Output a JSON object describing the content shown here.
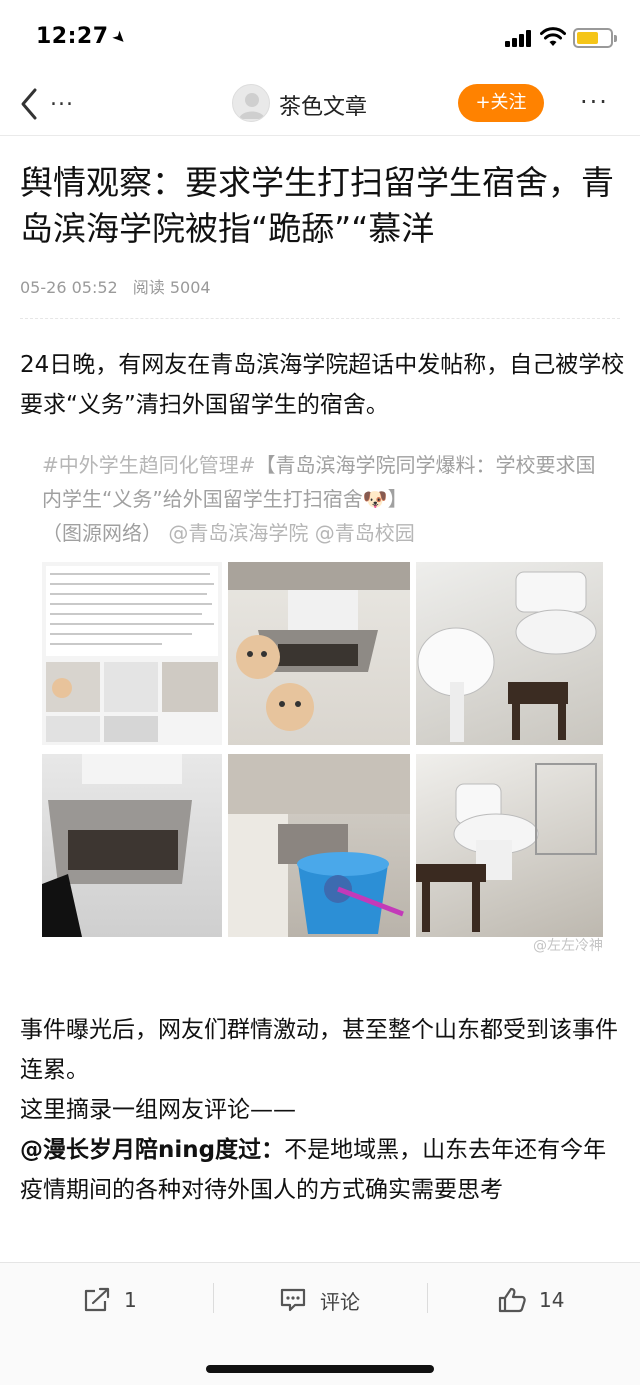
{
  "status": {
    "time": "12:27"
  },
  "nav": {
    "ellipsis": "...",
    "author": "茶色文章",
    "follow": "+关注",
    "more": "···"
  },
  "article": {
    "title": "舆情观察：要求学生打扫留学生宿舍，青岛滨海学院被指“跪舔”“慕洋",
    "date": "05-26 05:52",
    "reads": "阅读 5004",
    "p1": "24日晚，有网友在青岛滨海学院超话中发帖称，自己被学校要求“义务”清扫外国留学生的宿舍。",
    "p2_l1": "事件曝光后，网友们群情激动，甚至整个山东都受到该事件连累。",
    "p2_l2": "这里摘录一组网友评论——",
    "p2_user": "@漫长岁月陪ning度过：",
    "p2_text": "不是地域黑，山东去年还有今年疫情期间的各种对待外国人的方式确实需要思考"
  },
  "figure": {
    "caption_tag": "#中外学生趋同化管理#",
    "caption_main": "【青岛滨海学院同学爆料：学校要求国内学生“义务”给外国留学生打扫宿舍🐶】",
    "caption_src": "（图源网络）",
    "caption_mentions": "@青岛滨海学院 @青岛校园",
    "watermark": "@左左冷神"
  },
  "actions": {
    "share": "1",
    "comment": "评论",
    "like": "14"
  },
  "colors": {
    "accent": "#ff8200"
  }
}
